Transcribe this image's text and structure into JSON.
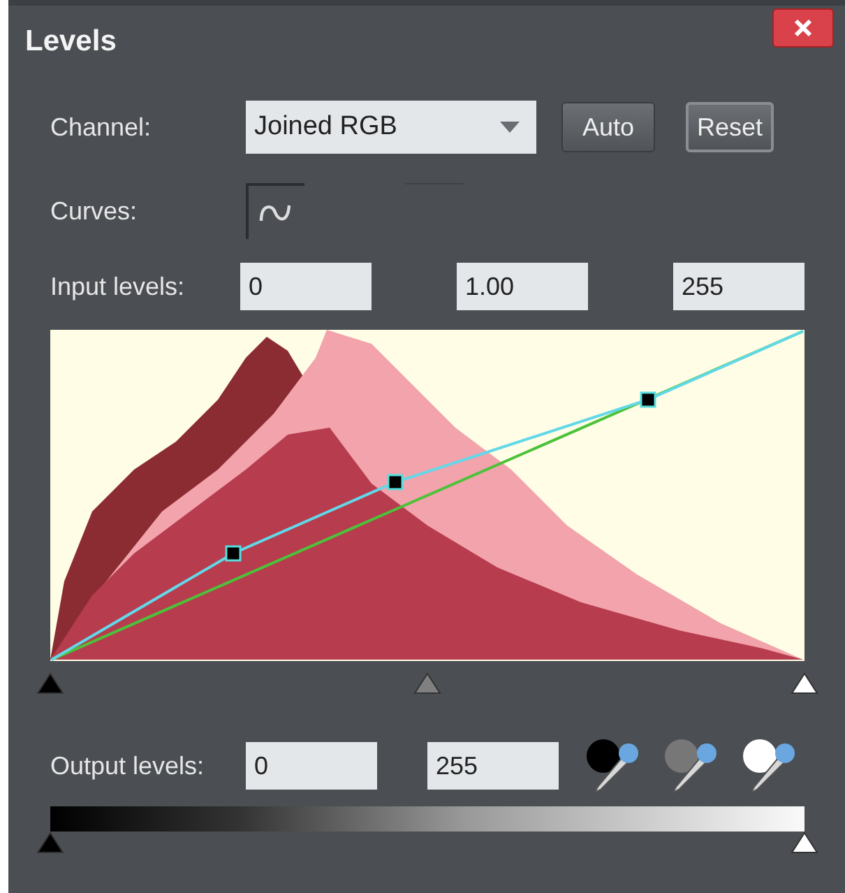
{
  "window": {
    "title": "Levels"
  },
  "channel": {
    "label": "Channel:",
    "value": "Joined RGB"
  },
  "buttons": [
    "Auto",
    "Reset"
  ],
  "curves": {
    "label": "Curves:",
    "modes": [
      {
        "selected": true
      },
      {
        "selected": false
      }
    ]
  },
  "input_levels": {
    "label": "Input levels:",
    "fields": [
      "0",
      "1.00",
      "255"
    ]
  },
  "output_levels": {
    "label": "Output levels:",
    "fields": [
      "0",
      "255"
    ]
  },
  "eyedroppers": [
    {
      "color": "#000000"
    },
    {
      "color": "#777777"
    },
    {
      "color": "#ffffff"
    }
  ]
}
